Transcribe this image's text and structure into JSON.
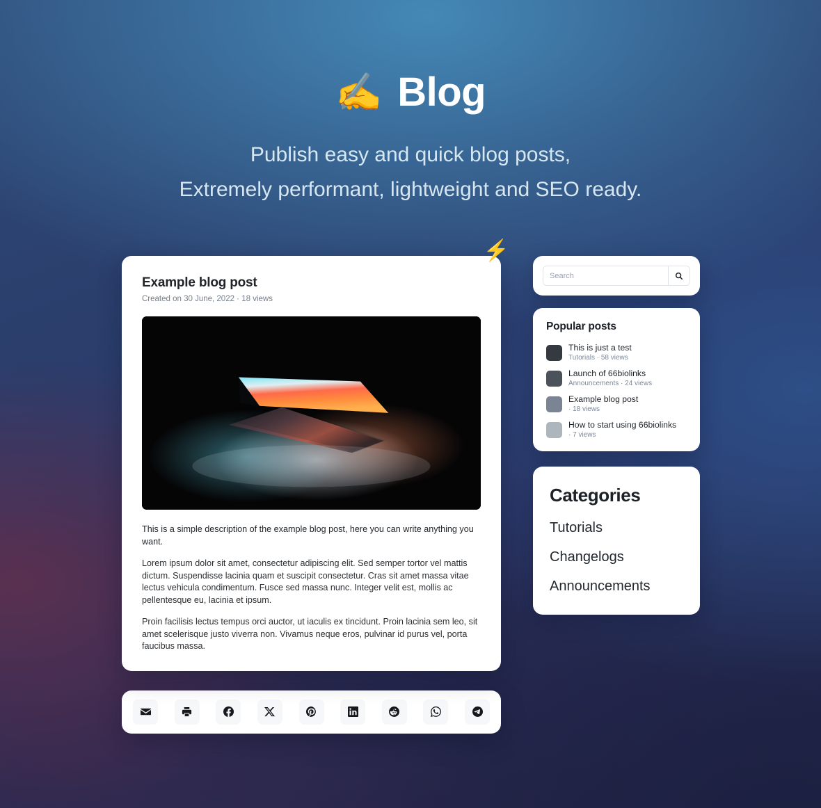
{
  "hero": {
    "emoji": "✍️",
    "emoji_name": "writing-hand-emoji",
    "title": "Blog",
    "subtitle_line1": "Publish easy and quick blog posts,",
    "subtitle_line2": "Extremely performant, lightweight and SEO ready."
  },
  "badge": {
    "emoji": "⚡",
    "name": "lightning-bolt-emoji"
  },
  "post": {
    "title": "Example blog post",
    "meta": "Created on 30 June, 2022 · 18 views",
    "image_alt": "Open laptop glowing in the dark with colorful screen light",
    "lead": "This is a simple description of the example blog post, here you can write anything you want.",
    "paragraphs": [
      "Lorem ipsum dolor sit amet, consectetur adipiscing elit. Sed semper tortor vel mattis dictum. Suspendisse lacinia quam et suscipit consectetur. Cras sit amet massa vitae lectus vehicula condimentum. Fusce sed massa nunc. Integer velit est, mollis ac pellentesque eu, lacinia et ipsum.",
      "Proin facilisis lectus tempus orci auctor, ut iaculis ex tincidunt. Proin lacinia sem leo, sit amet scelerisque justo viverra non. Vivamus neque eros, pulvinar id purus vel, porta faucibus massa."
    ]
  },
  "share": {
    "items": [
      {
        "name": "share-email-button",
        "icon": "email-icon"
      },
      {
        "name": "share-print-button",
        "icon": "print-icon"
      },
      {
        "name": "share-facebook-button",
        "icon": "facebook-icon"
      },
      {
        "name": "share-x-button",
        "icon": "x-twitter-icon"
      },
      {
        "name": "share-pinterest-button",
        "icon": "pinterest-icon"
      },
      {
        "name": "share-linkedin-button",
        "icon": "linkedin-icon"
      },
      {
        "name": "share-reddit-button",
        "icon": "reddit-icon"
      },
      {
        "name": "share-whatsapp-button",
        "icon": "whatsapp-icon"
      },
      {
        "name": "share-telegram-button",
        "icon": "telegram-icon"
      }
    ]
  },
  "search": {
    "placeholder": "Search",
    "value": "",
    "button_icon": "search-icon"
  },
  "popular": {
    "title": "Popular posts",
    "items": [
      {
        "title": "This is just a test",
        "meta": "Tutorials · 58 views",
        "color": "#343a40"
      },
      {
        "title": "Launch of 66biolinks",
        "meta": "Announcements · 24 views",
        "color": "#4b525c"
      },
      {
        "title": "Example blog post",
        "meta": "· 18 views",
        "color": "#7a8493"
      },
      {
        "title": "How to start using 66biolinks",
        "meta": "· 7 views",
        "color": "#adb5bd"
      }
    ]
  },
  "categories": {
    "title": "Categories",
    "items": [
      {
        "label": "Tutorials"
      },
      {
        "label": "Changelogs"
      },
      {
        "label": "Announcements"
      }
    ]
  },
  "colors": {
    "background_top": "#3c82b2",
    "background_left": "#3b2a4e",
    "background_right": "#1e2348",
    "card": "#ffffff",
    "text_dark": "#1d2228",
    "text_muted": "#7d879a"
  }
}
